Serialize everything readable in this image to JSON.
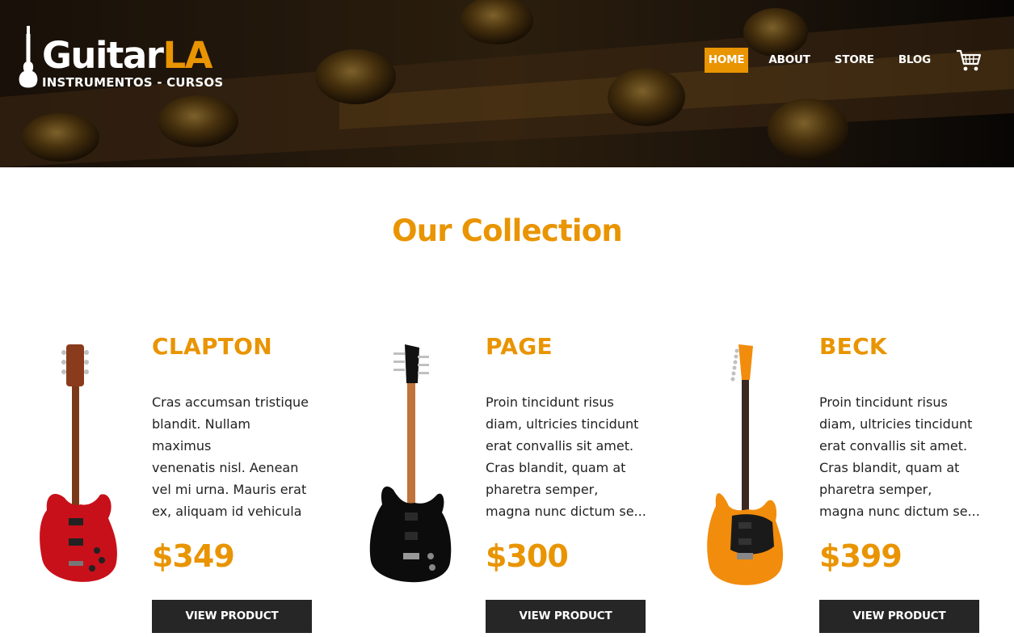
{
  "header": {
    "logo": {
      "name_part1": "Guitar",
      "name_part2": "LA",
      "tagline": "INSTRUMENTOS - CURSOS"
    },
    "nav": [
      {
        "label": "HOME",
        "active": true
      },
      {
        "label": "ABOUT",
        "active": false
      },
      {
        "label": "STORE",
        "active": false
      },
      {
        "label": "BLOG",
        "active": false
      }
    ],
    "cart_icon": "shopping-cart-icon"
  },
  "collection": {
    "title": "Our Collection",
    "products": [
      {
        "name": "CLAPTON",
        "description": "Cras accumsan tristique\nblandit. Nullam maximus\nvenenatis nisl. Aenean\nvel mi urna. Mauris erat\nex, aliquam id vehicula\nut, pharetra ac sem.",
        "price": "$349",
        "button": "VIEW PRODUCT",
        "guitar_color": "#c8101a"
      },
      {
        "name": "PAGE",
        "description": "Proin tincidunt risus\ndiam, ultricies tincidunt\nerat convallis sit amet.\nCras blandit, quam at\npharetra semper,\nmagna nunc dictum se...",
        "price": "$300",
        "button": "VIEW PRODUCT",
        "guitar_color": "#111111"
      },
      {
        "name": "BECK",
        "description": "Proin tincidunt risus\ndiam, ultricies tincidunt\nerat convallis sit amet.\nCras blandit, quam at\npharetra semper,\nmagna nunc dictum se...",
        "price": "$399",
        "button": "VIEW PRODUCT",
        "guitar_color": "#f28c0c"
      }
    ]
  },
  "colors": {
    "accent": "#e99401",
    "button_bg": "#262626",
    "text": "#222222"
  }
}
